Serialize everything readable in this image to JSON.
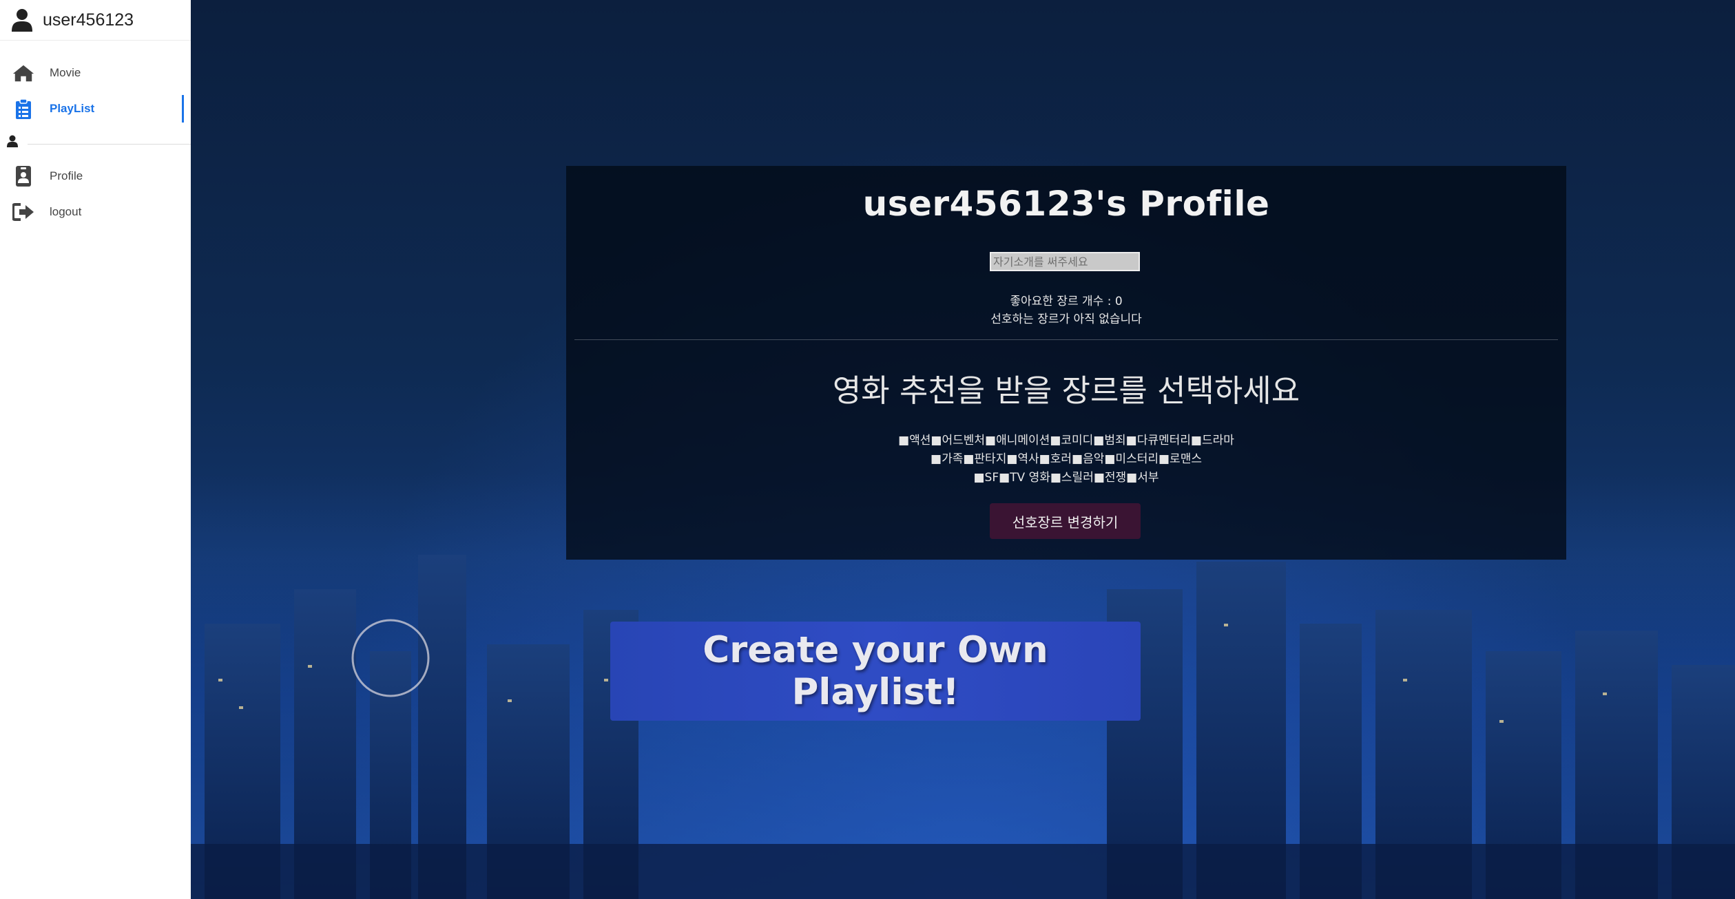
{
  "sidebar": {
    "username": "user456123",
    "items": [
      {
        "label": "Movie",
        "icon": "home-icon"
      },
      {
        "label": "PlayList",
        "icon": "clipboard-list-icon"
      }
    ],
    "account_items": [
      {
        "label": "Profile",
        "icon": "id-badge-icon"
      },
      {
        "label": "logout",
        "icon": "sign-out-icon"
      }
    ],
    "active_color": "#1a73e8"
  },
  "profile": {
    "title": "user456123's Profile",
    "intro_placeholder": "자기소개를 써주세요",
    "liked_genre_count": "좋아요한 장르 개수 : 0",
    "no_preference": "선호하는 장르가 아직 없습니다",
    "genre_heading": "영화 추천을 받을 장르를 선택하세요",
    "genre_rows": [
      "■액션■어드벤처■애니메이션■코미디■범죄■다큐멘터리■드라마",
      "■가족■판타지■역사■호러■음악■미스터리■로맨스",
      "■SF■TV 영화■스릴러■전쟁■서부"
    ],
    "change_button": "선호장르 변경하기"
  },
  "create_button": "Create your Own Playlist!"
}
